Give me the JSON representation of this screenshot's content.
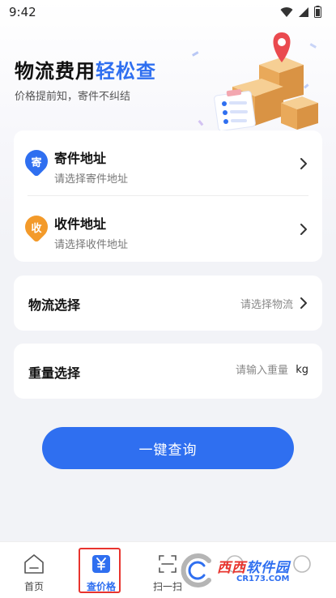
{
  "status_bar": {
    "time": "9:42",
    "icons": [
      "wifi-icon",
      "signal-icon",
      "battery-icon"
    ]
  },
  "hero": {
    "title_main": "物流费用",
    "title_accent": "轻松查",
    "subtitle": "价格提前知，寄件不纠结",
    "accent_color": "#2f6ff0"
  },
  "address": {
    "sender": {
      "badge": "寄",
      "title": "寄件地址",
      "hint": "请选择寄件地址"
    },
    "receiver": {
      "badge": "收",
      "title": "收件地址",
      "hint": "请选择收件地址"
    }
  },
  "logistics": {
    "label": "物流选择",
    "value": "请选择物流"
  },
  "weight": {
    "label": "重量选择",
    "placeholder": "请输入重量",
    "unit": "kg"
  },
  "query_button": {
    "label": "一键查询"
  },
  "bottom_nav": {
    "items": [
      {
        "label": "首页",
        "icon": "home-icon"
      },
      {
        "label": "查价格",
        "icon": "yen-icon",
        "active": true
      },
      {
        "label": "扫一扫",
        "icon": "scan-icon"
      }
    ]
  },
  "watermark": {
    "text_red": "西西",
    "text_blue": "软件园",
    "sub": "CR173.COM"
  }
}
